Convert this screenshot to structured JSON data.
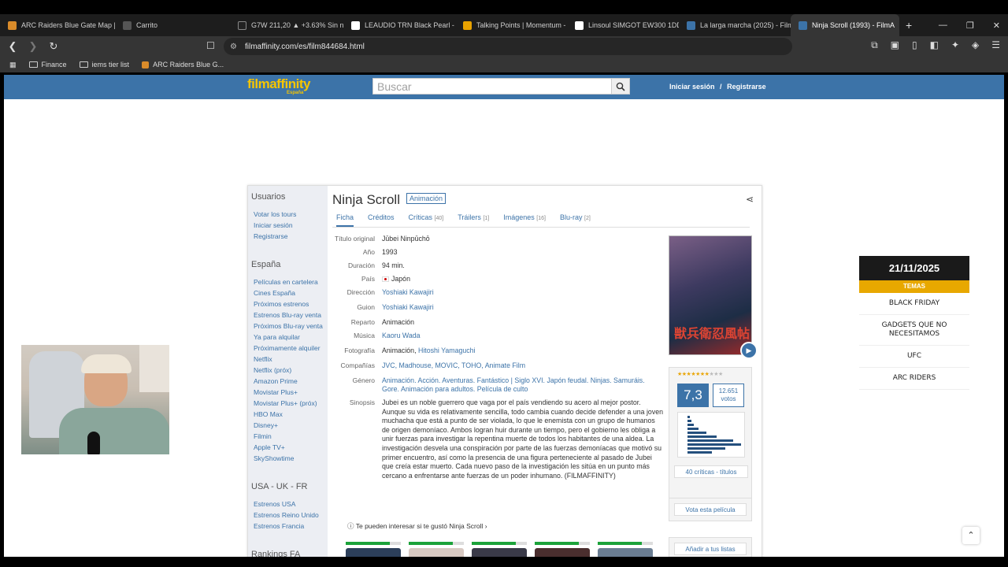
{
  "browser": {
    "tabs": [
      {
        "label": "ARC Raiders Blue Gate Map | M",
        "color": "#d98b2a"
      },
      {
        "label": "Carrito",
        "color": "#555555"
      },
      {
        "label": "G7W 211,20 ▲ +3.63% Sin nom",
        "color": "#222222"
      },
      {
        "label": "LEAUDIO TRN Black Pearl - De",
        "color": "#ffffff"
      },
      {
        "label": "Talking Points | Momentum - o",
        "color": "#e8a200"
      },
      {
        "label": "Linsoul SIMGOT EW300 1DD+",
        "color": "#ffffff"
      },
      {
        "label": "La larga marcha (2025) - FilmA",
        "color": "#3c73a8"
      },
      {
        "label": "Ninja Scroll (1993) - FilmA",
        "color": "#3c73a8",
        "active": true
      }
    ],
    "url": "filmaffinity.com/es/film844684.html",
    "bookmarks": [
      "Finance",
      "iems tier list",
      "ARC Raiders Blue G..."
    ]
  },
  "site": {
    "logo_main": "filmaffinity",
    "logo_sub": "España",
    "search_placeholder": "Buscar",
    "login": "Iniciar sesión",
    "separator": "/",
    "register": "Registrarse"
  },
  "sidebar": {
    "usuarios_title": "Usuarios",
    "usuarios": [
      "Votar los tours",
      "Iniciar sesión",
      "Registrarse"
    ],
    "espana_title": "España",
    "espana": [
      "Películas en cartelera",
      "Cines España",
      "Próximos estrenos",
      "Estrenos Blu-ray venta",
      "Próximos Blu-ray venta",
      "Ya para alquilar",
      "Próximamente alquiler",
      "Netflix",
      "Netflix (próx)",
      "Amazon Prime",
      "Movistar Plus+",
      "Movistar Plus+ (próx)",
      "HBO Max",
      "Disney+",
      "Filmin",
      "Apple TV+",
      "SkyShowtime"
    ],
    "usa_title": "USA - UK - FR",
    "usa": [
      "Estrenos USA",
      "Estrenos Reino Unido",
      "Estrenos Francia"
    ],
    "rankings_title": "Rankings FA"
  },
  "film": {
    "title": "Ninja Scroll",
    "badge": "Animación",
    "tabs": [
      {
        "label": "Ficha",
        "count": ""
      },
      {
        "label": "Créditos",
        "count": ""
      },
      {
        "label": "Críticas",
        "count": "[40]"
      },
      {
        "label": "Tráilers",
        "count": "[1]"
      },
      {
        "label": "Imágenes",
        "count": "[16]"
      },
      {
        "label": "Blu-ray",
        "count": "[2]"
      }
    ],
    "k_original": "Título original",
    "v_original": "Jūbei Ninpūchō",
    "k_year": "Año",
    "v_year": "1993",
    "k_duration": "Duración",
    "v_duration": "94 min.",
    "k_country": "País",
    "v_country": "Japón",
    "k_direction": "Dirección",
    "v_direction": "Yoshiaki Kawajiri",
    "k_script": "Guion",
    "v_script": "Yoshiaki Kawajiri",
    "k_cast": "Reparto",
    "v_cast": "Animación",
    "k_music": "Música",
    "v_music": "Kaoru Wada",
    "k_photo": "Fotografía",
    "v_photo_a": "Animación,",
    "v_photo_b": "Hitoshi Yamaguchi",
    "k_company": "Compañías",
    "v_company": "JVC, Madhouse, MOVIC, TOHO, Animate Film",
    "k_genre": "Género",
    "v_genre": "Animación. Acción. Aventuras. Fantástico | Siglo XVI. Japón feudal. Ninjas. Samuráis. Gore. Animación para adultos. Película de culto",
    "k_synopsis": "Sinopsis",
    "v_synopsis": "Jubei es un noble guerrero que vaga por el país vendiendo su acero al mejor postor. Aunque su vida es relativamente sencilla, todo cambia cuando decide defender a una joven muchacha que está a punto de ser violada, lo que le enemista con un grupo de humanos de origen demoníaco. Ambos logran huir durante un tiempo, pero el gobierno les obliga a unir fuerzas para investigar la repentina muerte de todos los habitantes de una aldea. La investigación desvela una conspiración por parte de las fuerzas demoníacas que motivó su primer encuentro, así como la presencia de una figura perteneciente al pasado de Jubei que creía estar muerto. Cada nuevo paso de la investigación les sitúa en un punto más cercano a enfrentarse ante fuerzas de un poder inhumano. (FILMAFFINITY)",
    "suggest": "Te pueden interesar si te gustó Ninja Scroll",
    "rating": "7,3",
    "stars": 7.3,
    "votes_count": "12.651",
    "votes_label": "votos",
    "histogram": [
      0.05,
      0.08,
      0.12,
      0.2,
      0.35,
      0.55,
      0.85,
      1.0,
      0.7,
      0.45
    ],
    "criticas_btn": "40 críticas - títulos",
    "vote_btn": "Vota esta película",
    "addlist_btn": "Añadir a tus listas",
    "poster_text": "獣兵衛忍風帖"
  },
  "ad": {
    "date": "21/11/2025",
    "temas": "TEMAS",
    "items": [
      "BLACK FRIDAY",
      "GADGETS QUE NO NECESITAMOS",
      "UFC",
      "ARC RIDERS"
    ]
  }
}
